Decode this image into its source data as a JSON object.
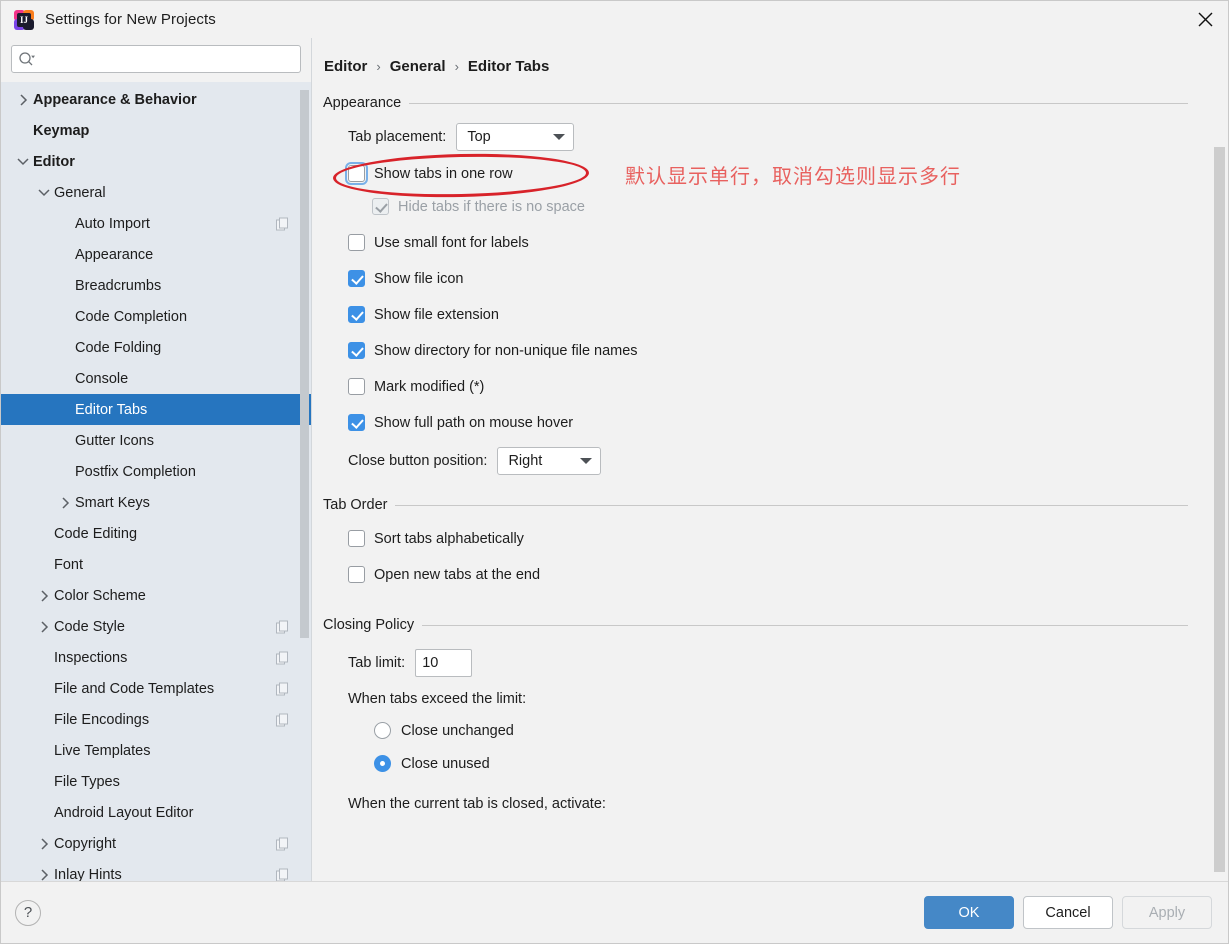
{
  "window": {
    "title": "Settings for New Projects",
    "app_icon": "intellij-idea-icon",
    "close_icon": "close-icon"
  },
  "search": {
    "placeholder": "",
    "value": "",
    "icon": "search-icon"
  },
  "sidebar": {
    "items": [
      {
        "label": "Appearance & Behavior",
        "indent": 0,
        "arrow": "right",
        "bold": true,
        "selected": false,
        "badge": false
      },
      {
        "label": "Keymap",
        "indent": 0,
        "arrow": "none",
        "bold": true,
        "selected": false,
        "badge": false
      },
      {
        "label": "Editor",
        "indent": 0,
        "arrow": "down",
        "bold": true,
        "selected": false,
        "badge": false
      },
      {
        "label": "General",
        "indent": 1,
        "arrow": "down",
        "bold": false,
        "selected": false,
        "badge": false
      },
      {
        "label": "Auto Import",
        "indent": 2,
        "arrow": "none",
        "bold": false,
        "selected": false,
        "badge": true
      },
      {
        "label": "Appearance",
        "indent": 2,
        "arrow": "none",
        "bold": false,
        "selected": false,
        "badge": false
      },
      {
        "label": "Breadcrumbs",
        "indent": 2,
        "arrow": "none",
        "bold": false,
        "selected": false,
        "badge": false
      },
      {
        "label": "Code Completion",
        "indent": 2,
        "arrow": "none",
        "bold": false,
        "selected": false,
        "badge": false
      },
      {
        "label": "Code Folding",
        "indent": 2,
        "arrow": "none",
        "bold": false,
        "selected": false,
        "badge": false
      },
      {
        "label": "Console",
        "indent": 2,
        "arrow": "none",
        "bold": false,
        "selected": false,
        "badge": false
      },
      {
        "label": "Editor Tabs",
        "indent": 2,
        "arrow": "none",
        "bold": false,
        "selected": true,
        "badge": false
      },
      {
        "label": "Gutter Icons",
        "indent": 2,
        "arrow": "none",
        "bold": false,
        "selected": false,
        "badge": false
      },
      {
        "label": "Postfix Completion",
        "indent": 2,
        "arrow": "none",
        "bold": false,
        "selected": false,
        "badge": false
      },
      {
        "label": "Smart Keys",
        "indent": 2,
        "arrow": "right",
        "bold": false,
        "selected": false,
        "badge": false
      },
      {
        "label": "Code Editing",
        "indent": 1,
        "arrow": "none",
        "bold": false,
        "selected": false,
        "badge": false
      },
      {
        "label": "Font",
        "indent": 1,
        "arrow": "none",
        "bold": false,
        "selected": false,
        "badge": false
      },
      {
        "label": "Color Scheme",
        "indent": 1,
        "arrow": "right",
        "bold": false,
        "selected": false,
        "badge": false
      },
      {
        "label": "Code Style",
        "indent": 1,
        "arrow": "right",
        "bold": false,
        "selected": false,
        "badge": true
      },
      {
        "label": "Inspections",
        "indent": 1,
        "arrow": "none",
        "bold": false,
        "selected": false,
        "badge": true
      },
      {
        "label": "File and Code Templates",
        "indent": 1,
        "arrow": "none",
        "bold": false,
        "selected": false,
        "badge": true
      },
      {
        "label": "File Encodings",
        "indent": 1,
        "arrow": "none",
        "bold": false,
        "selected": false,
        "badge": true
      },
      {
        "label": "Live Templates",
        "indent": 1,
        "arrow": "none",
        "bold": false,
        "selected": false,
        "badge": false
      },
      {
        "label": "File Types",
        "indent": 1,
        "arrow": "none",
        "bold": false,
        "selected": false,
        "badge": false
      },
      {
        "label": "Android Layout Editor",
        "indent": 1,
        "arrow": "none",
        "bold": false,
        "selected": false,
        "badge": false
      },
      {
        "label": "Copyright",
        "indent": 1,
        "arrow": "right",
        "bold": false,
        "selected": false,
        "badge": true
      },
      {
        "label": "Inlay Hints",
        "indent": 1,
        "arrow": "right",
        "bold": false,
        "selected": false,
        "badge": true
      }
    ]
  },
  "breadcrumb": {
    "crumbs": [
      "Editor",
      "General",
      "Editor Tabs"
    ],
    "separator": "›"
  },
  "appearance": {
    "title": "Appearance",
    "tab_placement_label": "Tab placement:",
    "tab_placement_value": "Top",
    "show_tabs_one_row": {
      "label": "Show tabs in one row",
      "checked": false,
      "focused": true
    },
    "hide_tabs_no_space": {
      "label": "Hide tabs if there is no space",
      "checked": true,
      "disabled": true
    },
    "use_small_font": {
      "label": "Use small font for labels",
      "checked": false
    },
    "show_file_icon": {
      "label": "Show file icon",
      "checked": true
    },
    "show_file_extension": {
      "label": "Show file extension",
      "checked": true
    },
    "show_directory": {
      "label": "Show directory for non-unique file names",
      "checked": true
    },
    "mark_modified": {
      "label": "Mark modified (*)",
      "checked": false
    },
    "show_full_path": {
      "label": "Show full path on mouse hover",
      "checked": true
    },
    "close_button_position_label": "Close button position:",
    "close_button_position_value": "Right"
  },
  "tab_order": {
    "title": "Tab Order",
    "sort_alphabetically": {
      "label": "Sort tabs alphabetically",
      "checked": false
    },
    "open_new_at_end": {
      "label": "Open new tabs at the end",
      "checked": false
    }
  },
  "closing_policy": {
    "title": "Closing Policy",
    "tab_limit_label": "Tab limit:",
    "tab_limit_value": "10",
    "exceed_label": "When tabs exceed the limit:",
    "close_unchanged": {
      "label": "Close unchanged",
      "selected": false
    },
    "close_unused": {
      "label": "Close unused",
      "selected": true
    },
    "current_closed_label": "When the current tab is closed, activate:"
  },
  "annotation": {
    "text": "默认显示单行，取消勾选则显示多行",
    "ellipse_color": "#d8232a",
    "text_color": "#e8615f"
  },
  "footer": {
    "help_label": "?",
    "ok_label": "OK",
    "cancel_label": "Cancel",
    "apply_label": "Apply",
    "ok_color": "#4588c7"
  }
}
